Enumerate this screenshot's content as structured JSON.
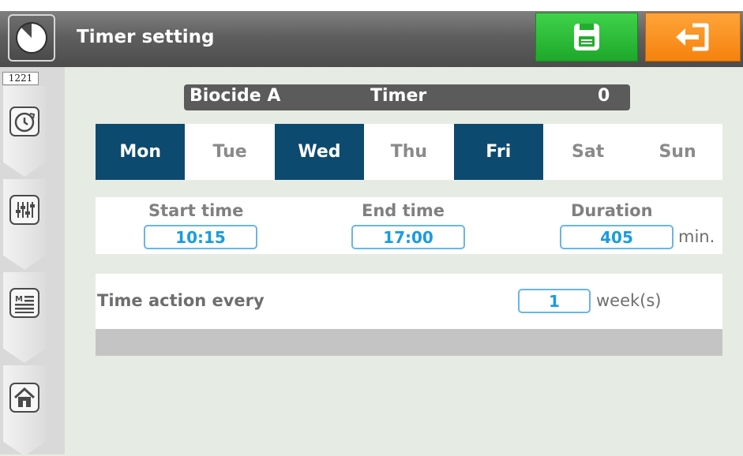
{
  "window": {
    "title": "Timer setting"
  },
  "toolbar": {
    "save_icon": "save-icon",
    "exit_icon": "exit-icon"
  },
  "sidebar": {
    "screen_id": "1221",
    "items": [
      {
        "icon": "timer-icon"
      },
      {
        "icon": "equalizer-icon"
      },
      {
        "icon": "menu-list-icon"
      },
      {
        "icon": "home-icon"
      }
    ]
  },
  "timer": {
    "name": "Biocide A",
    "label": "Timer",
    "index": "0"
  },
  "days": [
    {
      "label": "Mon",
      "active": true
    },
    {
      "label": "Tue",
      "active": false
    },
    {
      "label": "Wed",
      "active": true
    },
    {
      "label": "Thu",
      "active": false
    },
    {
      "label": "Fri",
      "active": true
    },
    {
      "label": "Sat",
      "active": false
    },
    {
      "label": "Sun",
      "active": false
    }
  ],
  "schedule": {
    "start_label": "Start time",
    "start_value": "10:15",
    "end_label": "End time",
    "end_value": "17:00",
    "duration_label": "Duration",
    "duration_value": "405",
    "duration_unit": "min."
  },
  "repeat": {
    "label": "Time action every",
    "value": "1",
    "unit": "week(s)"
  },
  "colors": {
    "active_day": "#0d4a6f",
    "inactive_day_text": "#8a8a8a",
    "field_text": "#1a9be0",
    "save_button": "#2dbd39",
    "exit_button": "#f68f1e"
  }
}
